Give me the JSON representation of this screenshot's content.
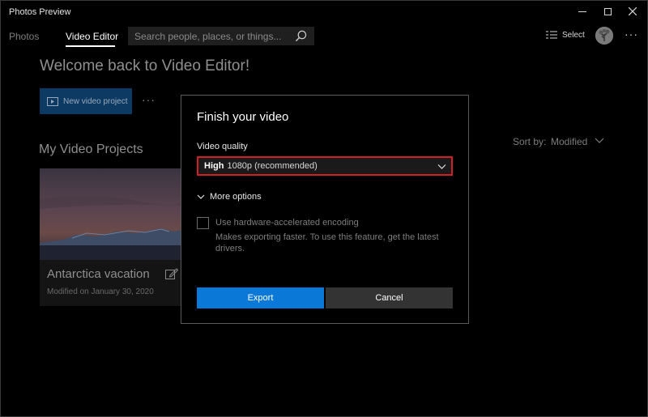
{
  "window": {
    "title": "Photos Preview"
  },
  "nav": {
    "tabs": [
      "Photos",
      "Video Editor"
    ],
    "active_tab": "Video Editor",
    "search_placeholder": "Search people, places, or things...",
    "select_label": "Select",
    "more_label": "···"
  },
  "main": {
    "welcome": "Welcome back to Video Editor!",
    "new_project_label": "New video project",
    "more_label": "···",
    "section_title": "My Video Projects",
    "sort_label": "Sort by:",
    "sort_value": "Modified"
  },
  "projects": [
    {
      "title": "Antarctica vacation",
      "modified": "Modified on January 30, 2020"
    }
  ],
  "dialog": {
    "title": "Finish your video",
    "quality_label": "Video quality",
    "quality_level": "High",
    "quality_detail": "1080p (recommended)",
    "more_options": "More options",
    "hw_checked": false,
    "hw_label": "Use hardware-accelerated encoding",
    "hw_description": "Makes exporting faster. To use this feature, get the latest drivers.",
    "export_label": "Export",
    "cancel_label": "Cancel"
  },
  "colors": {
    "accent": "#0a78d7",
    "highlight": "#d11f26",
    "background": "#000000"
  },
  "icons": [
    "minimize-icon",
    "maximize-icon",
    "close-icon",
    "search-icon",
    "select-icon",
    "avatar",
    "more-icon",
    "video-project-icon",
    "chevron-down-icon",
    "edit-icon",
    "checkbox"
  ]
}
